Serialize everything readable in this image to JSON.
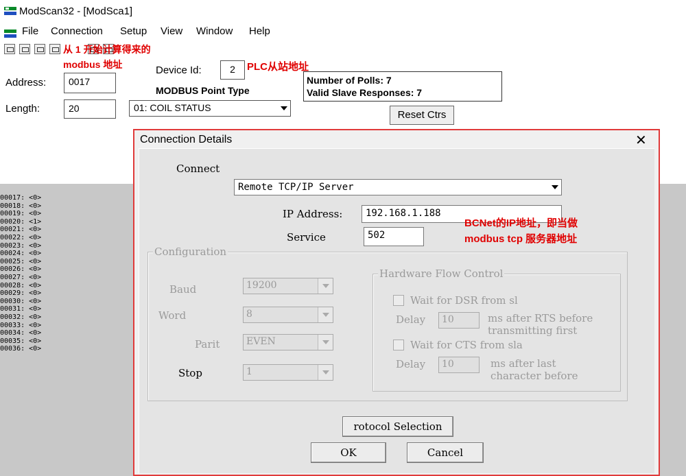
{
  "window": {
    "title": "ModScan32 - [ModSca1]"
  },
  "menu": {
    "items": [
      "File",
      "Connection",
      "Setup",
      "View",
      "Window",
      "Help"
    ]
  },
  "form": {
    "address_label": "Address:",
    "address_value": "0017",
    "length_label": "Length:",
    "length_value": "20",
    "device_id_label": "Device Id:",
    "device_id_value": "2",
    "point_type_label": "MODBUS Point Type",
    "point_type_value": "01: COIL STATUS",
    "stats_polls": "Number of Polls: 7",
    "stats_valid": "Valid Slave Responses: 7",
    "reset_label": "Reset Ctrs"
  },
  "notes": {
    "address_note_line1": "从 1 开始计算得来的",
    "address_note_line2": "modbus 地址",
    "device_note": "PLC从站地址",
    "ip_note_line1": "BCNet的IP地址，即当做",
    "ip_note_line2": "modbus tcp 服务器地址"
  },
  "data_list": [
    "00017: <0>",
    "00018: <0>",
    "00019: <0>",
    "00020: <1>",
    "00021: <0>",
    "00022: <0>",
    "00023: <0>",
    "00024: <0>",
    "00025: <0>",
    "00026: <0>",
    "00027: <0>",
    "00028: <0>",
    "00029: <0>",
    "00030: <0>",
    "00031: <0>",
    "00032: <0>",
    "00033: <0>",
    "00034: <0>",
    "00035: <0>",
    "00036: <0>"
  ],
  "dialog": {
    "title": "Connection Details",
    "close": "✕",
    "connect_label": "Connect",
    "connect_value": "Remote TCP/IP Server",
    "ip_label": "IP Address:",
    "ip_value": "192.168.1.188",
    "service_label": "Service",
    "service_value": "502",
    "config_legend": "Configuration",
    "baud_label": "Baud",
    "baud_value": "19200",
    "word_label": "Word",
    "word_value": "8",
    "parity_label": "Parit",
    "parity_value": "EVEN",
    "stop_label": "Stop",
    "stop_value": "1",
    "flow_legend": "Hardware Flow Control",
    "dsr_label": "Wait for DSR from sl",
    "delay1_label": "Delay",
    "delay1_value": "10",
    "delay1_note_line1": "ms after RTS before",
    "delay1_note_line2": "transmitting first",
    "cts_label": "Wait for CTS from sla",
    "delay2_label": "Delay",
    "delay2_value": "10",
    "delay2_note_line1": "ms after last",
    "delay2_note_line2": "character before",
    "protocol_label": "rotocol Selection",
    "ok_label": "OK",
    "cancel_label": "Cancel"
  }
}
